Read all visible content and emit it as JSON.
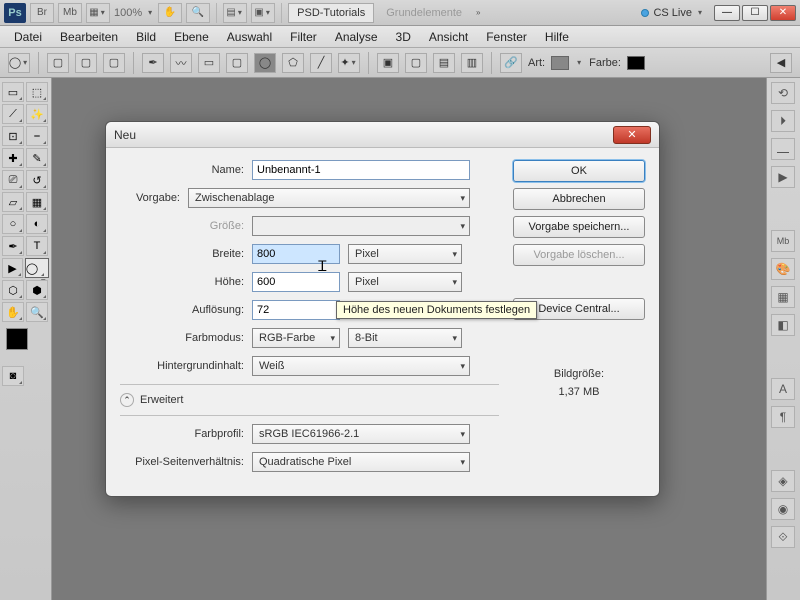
{
  "titlebar": {
    "logo": "Ps",
    "br": "Br",
    "mb": "Mb",
    "zoom": "100%",
    "tab_active": "PSD-Tutorials",
    "tab_inactive": "Grundelemente",
    "cslive": "CS Live"
  },
  "menu": [
    "Datei",
    "Bearbeiten",
    "Bild",
    "Ebene",
    "Auswahl",
    "Filter",
    "Analyse",
    "3D",
    "Ansicht",
    "Fenster",
    "Hilfe"
  ],
  "optbar": {
    "art": "Art:",
    "farbe": "Farbe:"
  },
  "dialog": {
    "title": "Neu",
    "name_label": "Name:",
    "name_value": "Unbenannt-1",
    "preset_label": "Vorgabe:",
    "preset_value": "Zwischenablage",
    "size_label": "Größe:",
    "width_label": "Breite:",
    "width_value": "800",
    "width_unit": "Pixel",
    "height_label": "Höhe:",
    "height_value": "600",
    "height_unit": "Pixel",
    "res_label": "Auflösung:",
    "res_value": "72",
    "mode_label": "Farbmodus:",
    "mode_value": "RGB-Farbe",
    "depth_value": "8-Bit",
    "bg_label": "Hintergrundinhalt:",
    "bg_value": "Weiß",
    "advanced": "Erweitert",
    "profile_label": "Farbprofil:",
    "profile_value": "sRGB IEC61966-2.1",
    "aspect_label": "Pixel-Seitenverhältnis:",
    "aspect_value": "Quadratische Pixel",
    "ok": "OK",
    "cancel": "Abbrechen",
    "save_preset": "Vorgabe speichern...",
    "delete_preset": "Vorgabe löschen...",
    "device_central": "Device Central...",
    "imgsize_label": "Bildgröße:",
    "imgsize_value": "1,37 MB",
    "tooltip": "Höhe des neuen Dokuments festlegen"
  }
}
